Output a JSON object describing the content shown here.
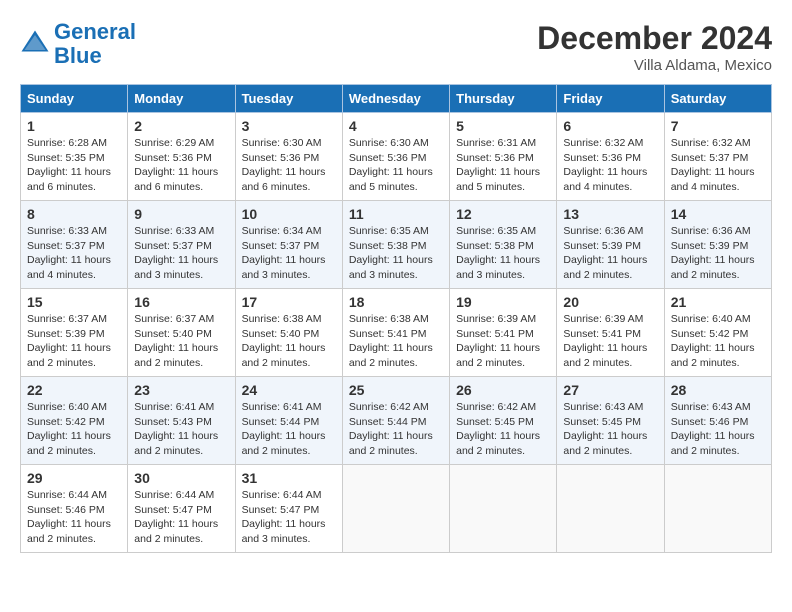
{
  "header": {
    "logo_line1": "General",
    "logo_line2": "Blue",
    "month": "December 2024",
    "location": "Villa Aldama, Mexico"
  },
  "days_of_week": [
    "Sunday",
    "Monday",
    "Tuesday",
    "Wednesday",
    "Thursday",
    "Friday",
    "Saturday"
  ],
  "weeks": [
    [
      {
        "day": 1,
        "lines": [
          "Sunrise: 6:28 AM",
          "Sunset: 5:35 PM",
          "Daylight: 11 hours",
          "and 6 minutes."
        ]
      },
      {
        "day": 2,
        "lines": [
          "Sunrise: 6:29 AM",
          "Sunset: 5:36 PM",
          "Daylight: 11 hours",
          "and 6 minutes."
        ]
      },
      {
        "day": 3,
        "lines": [
          "Sunrise: 6:30 AM",
          "Sunset: 5:36 PM",
          "Daylight: 11 hours",
          "and 6 minutes."
        ]
      },
      {
        "day": 4,
        "lines": [
          "Sunrise: 6:30 AM",
          "Sunset: 5:36 PM",
          "Daylight: 11 hours",
          "and 5 minutes."
        ]
      },
      {
        "day": 5,
        "lines": [
          "Sunrise: 6:31 AM",
          "Sunset: 5:36 PM",
          "Daylight: 11 hours",
          "and 5 minutes."
        ]
      },
      {
        "day": 6,
        "lines": [
          "Sunrise: 6:32 AM",
          "Sunset: 5:36 PM",
          "Daylight: 11 hours",
          "and 4 minutes."
        ]
      },
      {
        "day": 7,
        "lines": [
          "Sunrise: 6:32 AM",
          "Sunset: 5:37 PM",
          "Daylight: 11 hours",
          "and 4 minutes."
        ]
      }
    ],
    [
      {
        "day": 8,
        "lines": [
          "Sunrise: 6:33 AM",
          "Sunset: 5:37 PM",
          "Daylight: 11 hours",
          "and 4 minutes."
        ]
      },
      {
        "day": 9,
        "lines": [
          "Sunrise: 6:33 AM",
          "Sunset: 5:37 PM",
          "Daylight: 11 hours",
          "and 3 minutes."
        ]
      },
      {
        "day": 10,
        "lines": [
          "Sunrise: 6:34 AM",
          "Sunset: 5:37 PM",
          "Daylight: 11 hours",
          "and 3 minutes."
        ]
      },
      {
        "day": 11,
        "lines": [
          "Sunrise: 6:35 AM",
          "Sunset: 5:38 PM",
          "Daylight: 11 hours",
          "and 3 minutes."
        ]
      },
      {
        "day": 12,
        "lines": [
          "Sunrise: 6:35 AM",
          "Sunset: 5:38 PM",
          "Daylight: 11 hours",
          "and 3 minutes."
        ]
      },
      {
        "day": 13,
        "lines": [
          "Sunrise: 6:36 AM",
          "Sunset: 5:39 PM",
          "Daylight: 11 hours",
          "and 2 minutes."
        ]
      },
      {
        "day": 14,
        "lines": [
          "Sunrise: 6:36 AM",
          "Sunset: 5:39 PM",
          "Daylight: 11 hours",
          "and 2 minutes."
        ]
      }
    ],
    [
      {
        "day": 15,
        "lines": [
          "Sunrise: 6:37 AM",
          "Sunset: 5:39 PM",
          "Daylight: 11 hours",
          "and 2 minutes."
        ]
      },
      {
        "day": 16,
        "lines": [
          "Sunrise: 6:37 AM",
          "Sunset: 5:40 PM",
          "Daylight: 11 hours",
          "and 2 minutes."
        ]
      },
      {
        "day": 17,
        "lines": [
          "Sunrise: 6:38 AM",
          "Sunset: 5:40 PM",
          "Daylight: 11 hours",
          "and 2 minutes."
        ]
      },
      {
        "day": 18,
        "lines": [
          "Sunrise: 6:38 AM",
          "Sunset: 5:41 PM",
          "Daylight: 11 hours",
          "and 2 minutes."
        ]
      },
      {
        "day": 19,
        "lines": [
          "Sunrise: 6:39 AM",
          "Sunset: 5:41 PM",
          "Daylight: 11 hours",
          "and 2 minutes."
        ]
      },
      {
        "day": 20,
        "lines": [
          "Sunrise: 6:39 AM",
          "Sunset: 5:41 PM",
          "Daylight: 11 hours",
          "and 2 minutes."
        ]
      },
      {
        "day": 21,
        "lines": [
          "Sunrise: 6:40 AM",
          "Sunset: 5:42 PM",
          "Daylight: 11 hours",
          "and 2 minutes."
        ]
      }
    ],
    [
      {
        "day": 22,
        "lines": [
          "Sunrise: 6:40 AM",
          "Sunset: 5:42 PM",
          "Daylight: 11 hours",
          "and 2 minutes."
        ]
      },
      {
        "day": 23,
        "lines": [
          "Sunrise: 6:41 AM",
          "Sunset: 5:43 PM",
          "Daylight: 11 hours",
          "and 2 minutes."
        ]
      },
      {
        "day": 24,
        "lines": [
          "Sunrise: 6:41 AM",
          "Sunset: 5:44 PM",
          "Daylight: 11 hours",
          "and 2 minutes."
        ]
      },
      {
        "day": 25,
        "lines": [
          "Sunrise: 6:42 AM",
          "Sunset: 5:44 PM",
          "Daylight: 11 hours",
          "and 2 minutes."
        ]
      },
      {
        "day": 26,
        "lines": [
          "Sunrise: 6:42 AM",
          "Sunset: 5:45 PM",
          "Daylight: 11 hours",
          "and 2 minutes."
        ]
      },
      {
        "day": 27,
        "lines": [
          "Sunrise: 6:43 AM",
          "Sunset: 5:45 PM",
          "Daylight: 11 hours",
          "and 2 minutes."
        ]
      },
      {
        "day": 28,
        "lines": [
          "Sunrise: 6:43 AM",
          "Sunset: 5:46 PM",
          "Daylight: 11 hours",
          "and 2 minutes."
        ]
      }
    ],
    [
      {
        "day": 29,
        "lines": [
          "Sunrise: 6:44 AM",
          "Sunset: 5:46 PM",
          "Daylight: 11 hours",
          "and 2 minutes."
        ]
      },
      {
        "day": 30,
        "lines": [
          "Sunrise: 6:44 AM",
          "Sunset: 5:47 PM",
          "Daylight: 11 hours",
          "and 2 minutes."
        ]
      },
      {
        "day": 31,
        "lines": [
          "Sunrise: 6:44 AM",
          "Sunset: 5:47 PM",
          "Daylight: 11 hours",
          "and 3 minutes."
        ]
      },
      null,
      null,
      null,
      null
    ]
  ]
}
